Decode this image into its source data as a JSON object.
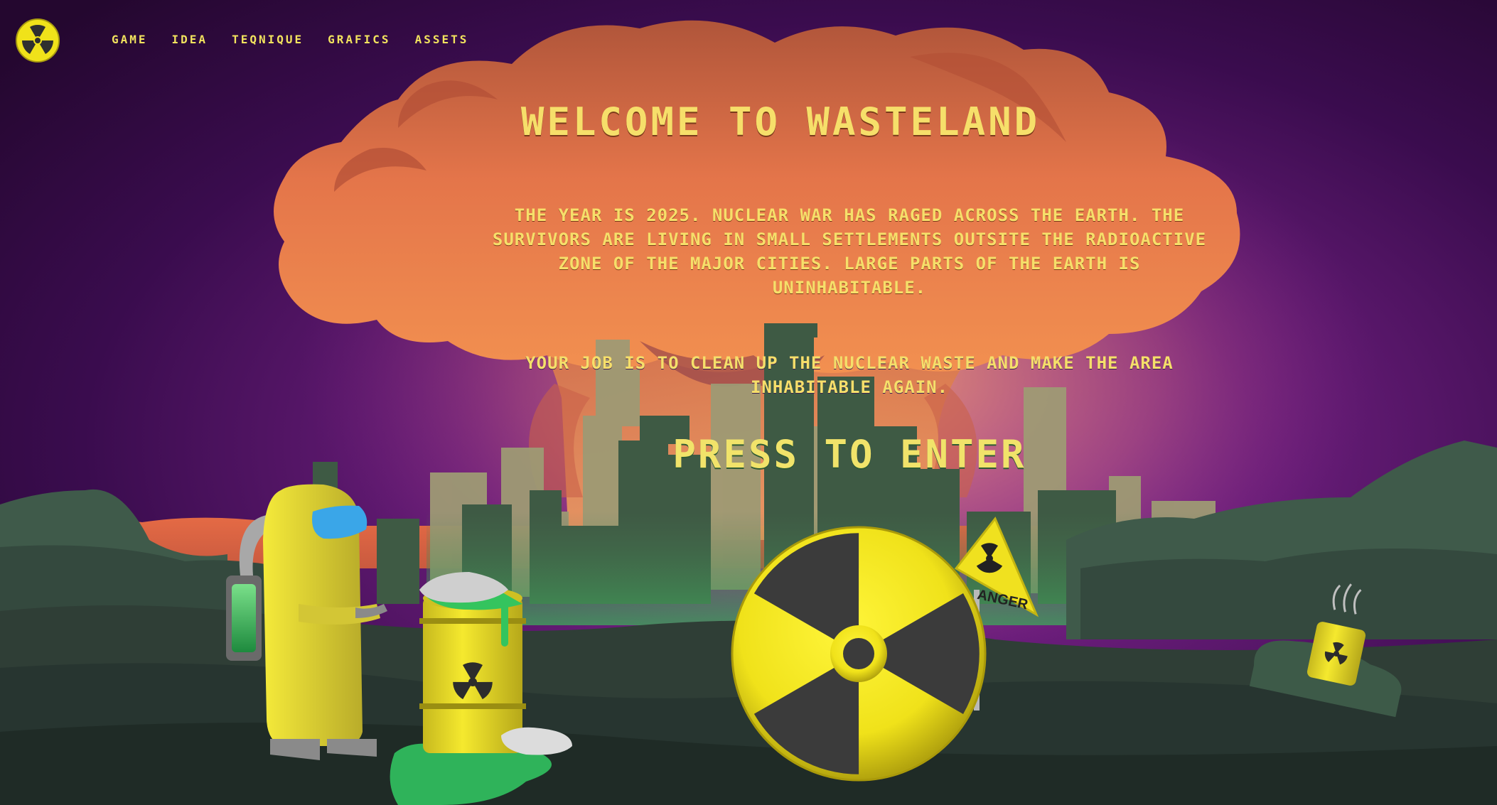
{
  "nav": {
    "links": [
      "GAME",
      "IDEA",
      "TEQNIQUE",
      "GRAFICS",
      "ASSETS"
    ]
  },
  "hero": {
    "title": "WELCOME TO WASTELAND",
    "intro": "THE YEAR IS 2025. NUCLEAR WAR HAS RAGED ACROSS THE EARTH. THE SURVIVORS ARE LIVING IN SMALL SETTLEMENTS OUTSITE THE RADIOACTIVE ZONE OF THE MAJOR CITIES. LARGE PARTS OF THE EARTH IS UNINHABITABLE.",
    "mission": "YOUR JOB IS TO CLEAN UP THE NUCLEAR WASTE AND MAKE THE AREA INHABITABLE AGAIN.",
    "cta": "PRESS TO ENTER"
  },
  "sign": {
    "text": "ANGER"
  },
  "icons": {
    "logo": "radiation-icon"
  },
  "colors": {
    "sky_dark": "#2a0a3a",
    "cloud": "#e9804a",
    "text_yellow": "#f6df6a",
    "ground": "#2f3e36",
    "hazard_yellow": "#f1e51e",
    "slime": "#3bd36a"
  }
}
